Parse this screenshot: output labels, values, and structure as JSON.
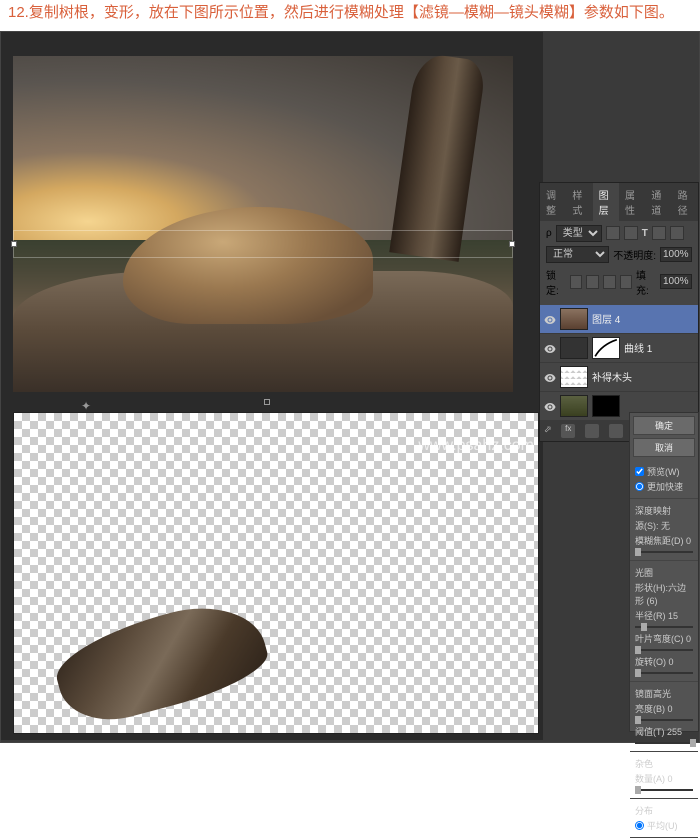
{
  "instruction": "12.复制树根，变形，放在下图所示位置，然后进行模糊处理【滤镜—模糊—镜头模糊】参数如下图。",
  "watermark": "www.psahz.com",
  "layers_panel": {
    "tabs": [
      "调整",
      "样式",
      "图层",
      "属性",
      "通道",
      "路径"
    ],
    "active_tab": "图层",
    "type_label": "类型",
    "blend_mode": "正常",
    "opacity_label": "不透明度:",
    "opacity_value": "100%",
    "lock_label": "锁定:",
    "fill_label": "填充:",
    "fill_value": "100%",
    "layers": [
      {
        "name": "图层 4",
        "visible": true,
        "selected": true,
        "thumb": "bear"
      },
      {
        "name": "曲线 1",
        "visible": true,
        "selected": false,
        "thumb": "curve"
      },
      {
        "name": "补得木头",
        "visible": true,
        "selected": false,
        "thumb": "wood"
      },
      {
        "name": "",
        "visible": true,
        "selected": false,
        "thumb": "bg"
      }
    ]
  },
  "blur_panel": {
    "ok_button": "确定",
    "cancel_button": "取消",
    "preview_check": "预览(W)",
    "faster_label": "更加快速",
    "section_depth": "深度映射",
    "source_label": "源(S):",
    "source_value": "无",
    "focal_label": "模糊焦距(D)",
    "focal_value": "0",
    "section_iris": "光圈",
    "shape_label": "形状(H):",
    "shape_value": "六边形 (6)",
    "radius_label": "半径(R)",
    "radius_value": "15",
    "blade_label": "叶片弯度(C)",
    "blade_value": "0",
    "rotation_label": "旋转(O)",
    "rotation_value": "0",
    "section_spec": "镜面高光",
    "brightness_label": "亮度(B)",
    "brightness_value": "0",
    "threshold_label": "阈值(T)",
    "threshold_value": "255",
    "section_noise": "杂色",
    "amount_label": "数量(A)",
    "amount_value": "0",
    "section_dist": "分布",
    "uniform_label": "平均(U)"
  }
}
